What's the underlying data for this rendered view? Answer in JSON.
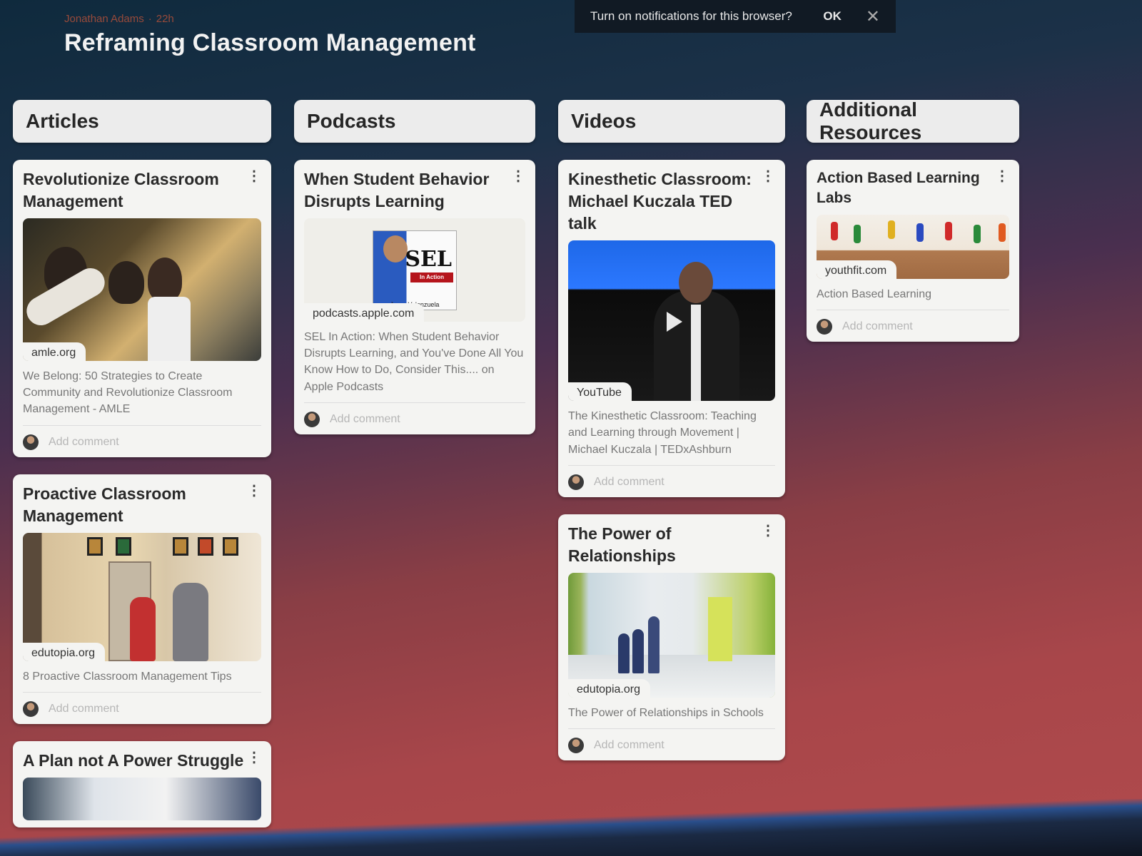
{
  "header": {
    "author": "Jonathan Adams",
    "time": "22h",
    "title": "Reframing Classroom Management"
  },
  "notification": {
    "message": "Turn on notifications for this browser?",
    "ok_label": "OK",
    "close_icon": "close-icon"
  },
  "columns": [
    {
      "title": "Articles",
      "cards": [
        {
          "title": "Revolutionize Classroom Management",
          "domain": "amle.org",
          "description": "We Belong: 50 Strategies to Create Community and Revolutionize Classroom Management - AMLE",
          "comment_placeholder": "Add comment"
        },
        {
          "title": "Proactive Classroom Management",
          "domain": "edutopia.org",
          "description": "8 Proactive Classroom Management Tips",
          "comment_placeholder": "Add comment"
        },
        {
          "title": "A Plan not A Power Struggle"
        }
      ]
    },
    {
      "title": "Podcasts",
      "cards": [
        {
          "title": "When Student Behavior Disrupts Learning",
          "domain": "podcasts.apple.com",
          "thumb_logo": "SEL",
          "thumb_band": "In Action",
          "thumb_name": "Jorge Valenzuela",
          "description": "SEL In Action: When Student Behavior Disrupts Learning, and You've Done All You Know How to Do, Consider This.... on Apple Podcasts",
          "comment_placeholder": "Add comment"
        }
      ]
    },
    {
      "title": "Videos",
      "cards": [
        {
          "title": "Kinesthetic Classroom: Michael Kuczala TED talk",
          "domain": "YouTube",
          "description": "The Kinesthetic Classroom: Teaching and Learning through Movement | Michael Kuczala | TEDxAshburn",
          "comment_placeholder": "Add comment"
        },
        {
          "title": "The Power of Relationships",
          "domain": "edutopia.org",
          "description": "The Power of Relationships in Schools",
          "comment_placeholder": "Add comment"
        }
      ]
    },
    {
      "title": "Additional Resources",
      "cards": [
        {
          "title": "Action Based Learning Labs",
          "domain": "youthfit.com",
          "description": "Action Based Learning",
          "comment_placeholder": "Add comment"
        }
      ]
    }
  ]
}
